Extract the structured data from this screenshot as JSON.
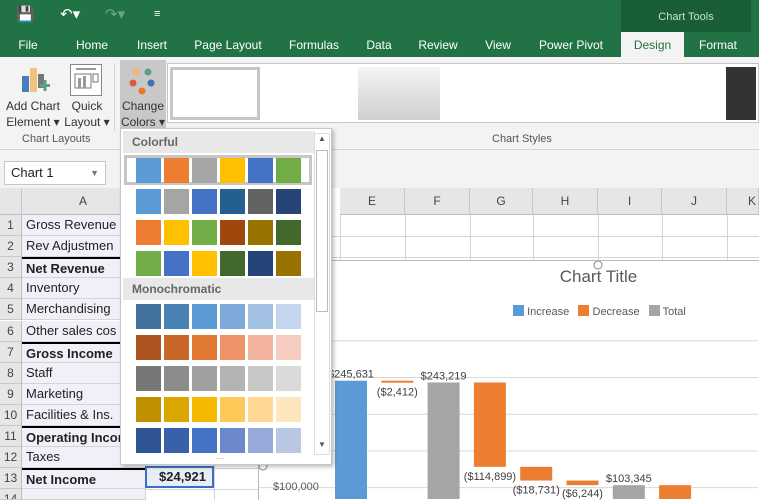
{
  "qat": {
    "save_icon": "save-icon",
    "undo_icon": "undo-icon",
    "redo_icon": "redo-icon",
    "customize_icon": "customize-qat-icon"
  },
  "context_tab": "Chart Tools",
  "tabs": [
    "File",
    "Home",
    "Insert",
    "Page Layout",
    "Formulas",
    "Data",
    "Review",
    "View",
    "Power Pivot",
    "Design",
    "Format"
  ],
  "active_tab": "Design",
  "ribbon": {
    "add_chart_element": [
      "Add Chart",
      "Element ▾"
    ],
    "quick_layout": [
      "Quick",
      "Layout ▾"
    ],
    "change_colors": [
      "Change",
      "Colors ▾"
    ],
    "group_chart_layouts": "Chart Layouts",
    "group_chart_styles": "Chart Styles"
  },
  "name_box": "Chart 1",
  "columns": [
    "A",
    "E",
    "F",
    "G",
    "H",
    "I",
    "J",
    "K"
  ],
  "rows": [
    {
      "n": "1",
      "label": "Gross Revenue",
      "bold": false
    },
    {
      "n": "2",
      "label": "Rev Adjustmen",
      "bold": false
    },
    {
      "n": "3",
      "label": "Net Revenue",
      "bold": true
    },
    {
      "n": "4",
      "label": "Inventory",
      "bold": false
    },
    {
      "n": "5",
      "label": "Merchandising",
      "bold": false
    },
    {
      "n": "6",
      "label": "Other sales cos",
      "bold": false
    },
    {
      "n": "7",
      "label": "Gross Income",
      "bold": true
    },
    {
      "n": "8",
      "label": "Staff",
      "bold": false
    },
    {
      "n": "9",
      "label": "Marketing",
      "bold": false
    },
    {
      "n": "10",
      "label": "Facilities & Ins.",
      "bold": false
    },
    {
      "n": "11",
      "label": "Operating Incor",
      "bold": true
    },
    {
      "n": "12",
      "label": "Taxes",
      "bold": false
    },
    {
      "n": "13",
      "label": "Net Income",
      "bold": true
    },
    {
      "n": "14",
      "label": "",
      "bold": false
    }
  ],
  "b13_value": "$24,921",
  "dropdown": {
    "colorful_label": "Colorful",
    "monochromatic_label": "Monochromatic",
    "colorful": [
      [
        "#5b9bd5",
        "#ed7d31",
        "#a5a5a5",
        "#ffc000",
        "#4472c4",
        "#70ad47"
      ],
      [
        "#5b9bd5",
        "#a5a5a5",
        "#4472c4",
        "#255e91",
        "#636363",
        "#264478"
      ],
      [
        "#ed7d31",
        "#ffc000",
        "#70ad47",
        "#9e480e",
        "#997300",
        "#43682b"
      ],
      [
        "#70ad47",
        "#4472c4",
        "#ffc000",
        "#43682b",
        "#264478",
        "#997300"
      ]
    ],
    "mono": [
      [
        "#41719c",
        "#4a81b5",
        "#5b9bd5",
        "#7eaadb",
        "#a2c0e4",
        "#c4d6ee"
      ],
      [
        "#ad5520",
        "#c96728",
        "#e17933",
        "#ef9369",
        "#f3b49e",
        "#f6cdc0"
      ],
      [
        "#777777",
        "#8c8c8c",
        "#a0a0a0",
        "#b3b3b3",
        "#c7c7c7",
        "#dadada"
      ],
      [
        "#bf8f00",
        "#dba600",
        "#f5ba00",
        "#ffc95a",
        "#ffd893",
        "#ffe5bd"
      ],
      [
        "#2f5597",
        "#3961a8",
        "#4472c4",
        "#6a88cb",
        "#97a9d8",
        "#bac7e4"
      ]
    ]
  },
  "chart_data": {
    "type": "bar",
    "title": "Chart Title",
    "legend": [
      {
        "name": "Increase",
        "color": "#5b9bd5"
      },
      {
        "name": "Decrease",
        "color": "#ed7d31"
      },
      {
        "name": "Total",
        "color": "#a5a5a5"
      }
    ],
    "legend_position": "top",
    "ytick_visible": "$100,000",
    "ylim": [
      0,
      300000
    ],
    "gridlines": [
      100000,
      150000,
      200000,
      250000,
      300000
    ],
    "bars": [
      {
        "kind": "Increase",
        "start": 0,
        "end": 245631,
        "label": "$245,631"
      },
      {
        "kind": "Decrease",
        "start": 245631,
        "end": 243219,
        "label": "($2,412)"
      },
      {
        "kind": "Total",
        "start": 0,
        "end": 243219,
        "label": "$243,219"
      },
      {
        "kind": "Decrease",
        "start": 243219,
        "end": 128320,
        "label": "($114,899)"
      },
      {
        "kind": "Decrease",
        "start": 128320,
        "end": 109589,
        "label": "($18,731)"
      },
      {
        "kind": "Decrease",
        "start": 109589,
        "end": 103345,
        "label": "($6,244)"
      },
      {
        "kind": "Total",
        "start": 0,
        "end": 103345,
        "label": "$103,345"
      },
      {
        "kind": "Decrease",
        "start": 103345,
        "end": 80000,
        "label": ""
      }
    ]
  }
}
